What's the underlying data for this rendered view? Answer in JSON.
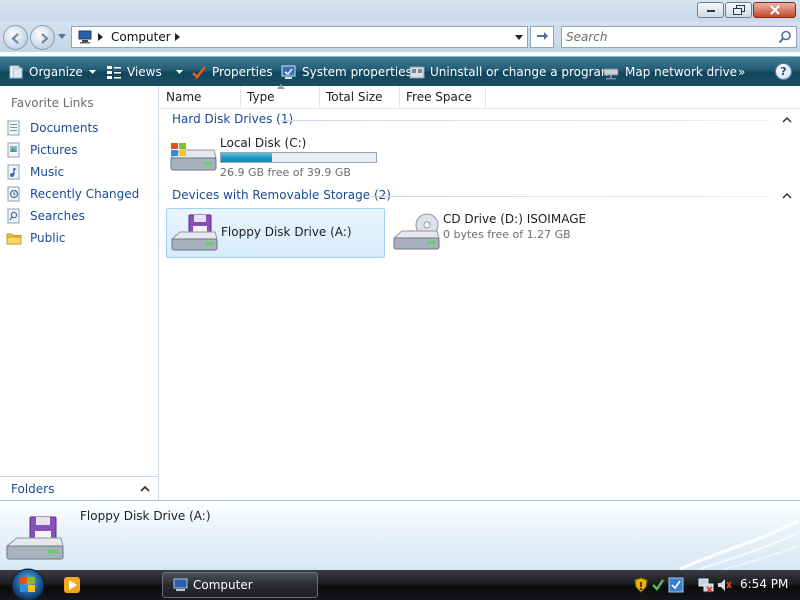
{
  "window": {
    "caption_buttons": [
      "minimize-icon",
      "maximize-icon",
      "close-icon"
    ]
  },
  "address_bar": {
    "location": "Computer",
    "search_placeholder": "Search"
  },
  "command_bar": {
    "organize": "Organize",
    "views": "Views",
    "properties": "Properties",
    "system_properties": "System properties",
    "uninstall": "Uninstall or change a program",
    "map_drive": "Map network drive",
    "more": "»",
    "help": "?"
  },
  "nav_pane": {
    "favorite_links_title": "Favorite Links",
    "items": [
      {
        "label": "Documents",
        "icon": "documents-icon"
      },
      {
        "label": "Pictures",
        "icon": "pictures-icon"
      },
      {
        "label": "Music",
        "icon": "music-icon"
      },
      {
        "label": "Recently Changed",
        "icon": "recently-changed-icon"
      },
      {
        "label": "Searches",
        "icon": "searches-icon"
      },
      {
        "label": "Public",
        "icon": "public-folder-icon"
      }
    ],
    "folders_label": "Folders"
  },
  "columns": [
    "Name",
    "Type",
    "Total Size",
    "Free Space"
  ],
  "groups": {
    "hard_disks": {
      "title": "Hard Disk Drives (1)",
      "items": [
        {
          "name": "Local Disk (C:)",
          "sub": "26.9 GB free of 39.9 GB",
          "used_fraction": 0.326
        }
      ]
    },
    "removable": {
      "title": "Devices with Removable Storage (2)",
      "items": [
        {
          "name": "Floppy Disk Drive (A:)",
          "selected": true
        },
        {
          "name": "CD Drive (D:) ISOIMAGE",
          "sub": "0 bytes free of 1.27 GB"
        }
      ]
    }
  },
  "details": {
    "name": "Floppy Disk Drive (A:)"
  },
  "taskbar": {
    "task_label": "Computer",
    "clock": "6:54 PM"
  },
  "colors": {
    "accent_link": "#1a4a96",
    "command_bar": "#22586f",
    "capacity_fill": "#1e93bf"
  }
}
